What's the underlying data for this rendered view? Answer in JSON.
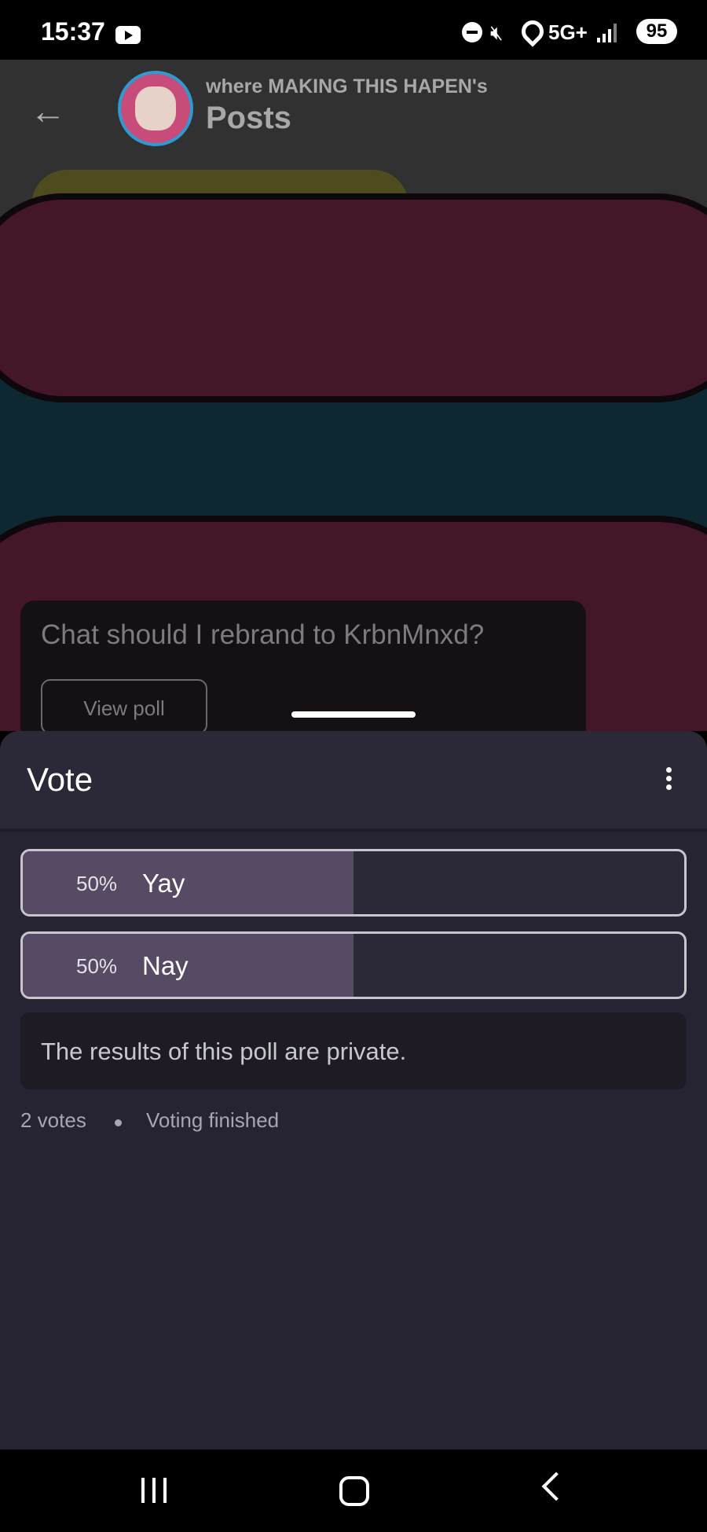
{
  "status_bar": {
    "time": "15:37",
    "network": "5G+",
    "battery": "95",
    "icons": [
      "youtube-icon",
      "do-not-disturb-icon",
      "mute-icon",
      "location-icon",
      "signal-icon",
      "battery-icon"
    ]
  },
  "header": {
    "subtitle": "where MAKING THIS HAPEN's",
    "title": "Posts",
    "back_icon": "arrow-left-icon"
  },
  "post": {
    "question": "Chat should I rebrand to KrbnMnxd?",
    "view_poll_label": "View poll"
  },
  "sheet": {
    "title": "Vote",
    "more_icon": "more-vertical-icon",
    "options": [
      {
        "percent_label": "50%",
        "label": "Yay",
        "fill_fraction": 0.5
      },
      {
        "percent_label": "50%",
        "label": "Nay",
        "fill_fraction": 0.5
      }
    ],
    "private_note": "The results of this poll are private.",
    "votes": "2 votes",
    "status": "Voting finished"
  },
  "colors": {
    "sheet_bg": "#262333",
    "option_fill": "#574a64",
    "option_border": "#c8c6cc"
  },
  "nav": {
    "icons": [
      "recents-icon",
      "home-icon",
      "back-icon"
    ]
  }
}
